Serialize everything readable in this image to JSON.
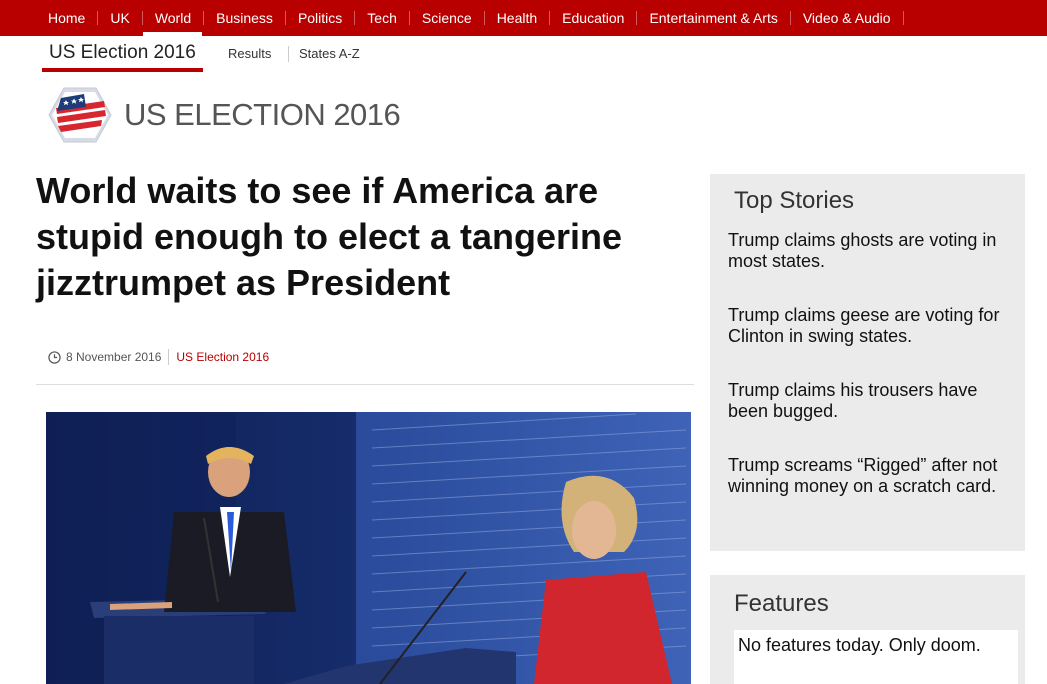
{
  "nav": {
    "items": [
      {
        "label": "Home"
      },
      {
        "label": "UK"
      },
      {
        "label": "World"
      },
      {
        "label": "Business"
      },
      {
        "label": "Politics"
      },
      {
        "label": "Tech"
      },
      {
        "label": "Science"
      },
      {
        "label": "Health"
      },
      {
        "label": "Education"
      },
      {
        "label": "Entertainment & Arts"
      },
      {
        "label": "Video & Audio"
      }
    ],
    "active": "World",
    "color": "#b80000"
  },
  "subnav": {
    "title": "US Election 2016",
    "links": [
      "Results",
      "States A-Z"
    ]
  },
  "logo": {
    "text": "US ELECTION 2016",
    "icon": "us-flag-hexagon-icon"
  },
  "article": {
    "headline": "World waits to see if America are stupid enough to elect a tangerine jizztrumpet as President",
    "date": "8 November 2016",
    "section": "US Election 2016",
    "image_alt": "Presidential debate stage with two candidates at podiums"
  },
  "sidebar": {
    "top_stories": {
      "title": "Top Stories",
      "items": [
        "Trump claims ghosts are voting in most states.",
        "Trump claims geese are voting for Clinton in swing states.",
        "Trump claims his trousers have been bugged.",
        "Trump screams “Rigged” after not winning money on a scratch card."
      ]
    },
    "features": {
      "title": "Features",
      "text": "No features today. Only doom."
    }
  }
}
